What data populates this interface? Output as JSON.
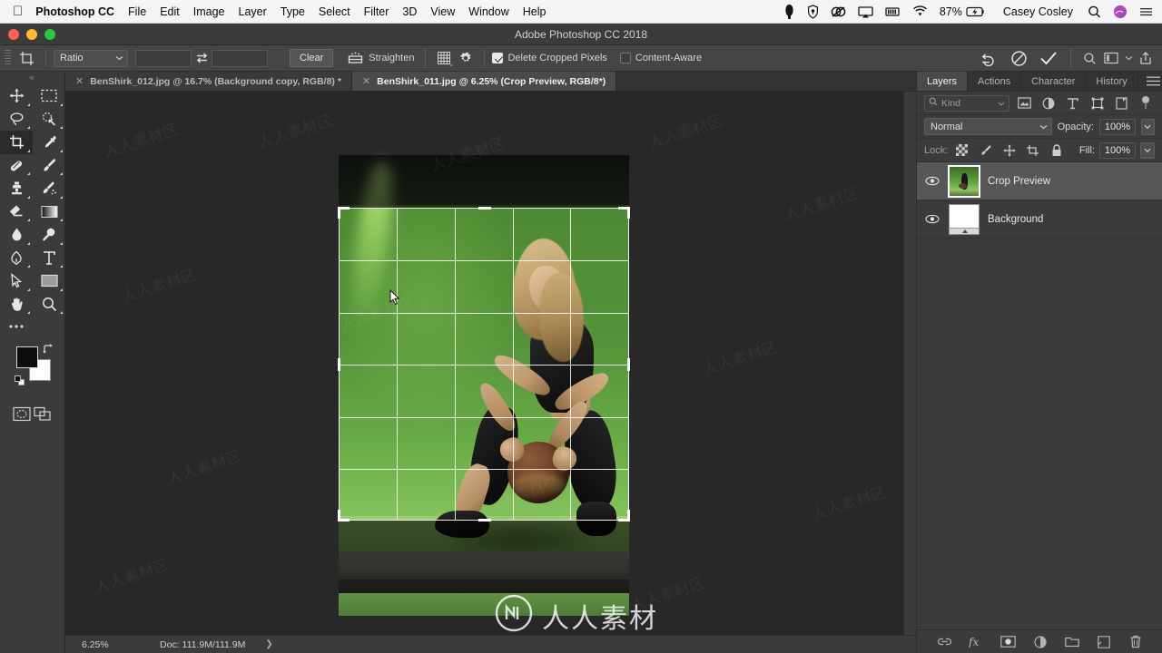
{
  "macbar": {
    "apple_icon": "apple-logo-icon",
    "app_name": "Photoshop CC",
    "menus": [
      "File",
      "Edit",
      "Image",
      "Layer",
      "Type",
      "Select",
      "Filter",
      "3D",
      "View",
      "Window",
      "Help"
    ],
    "status_icons": [
      "dropbox-icon",
      "shield-icon",
      "adobe-cc-icon",
      "airplay-icon",
      "battery-bar-icon",
      "wifi-icon"
    ],
    "battery_percent": "87%",
    "battery_charging_icon": "battery-charging-icon",
    "username": "Casey Cosley",
    "spotlight_icon": "search-icon",
    "siri_icon": "siri-icon",
    "control_center_icon": "list-icon"
  },
  "titlebar": {
    "title": "Adobe Photoshop CC 2018",
    "close_label": "close",
    "minimize_label": "minimize",
    "zoom_label": "zoom"
  },
  "options_bar": {
    "tool_icon": "crop-tool-icon",
    "ratio_select": "Ratio",
    "width_value": "",
    "height_value": "",
    "swap_icon": "swap-arrows-icon",
    "clear_label": "Clear",
    "straighten_icon": "straighten-icon",
    "straighten_label": "Straighten",
    "overlay_icon": "crop-overlay-grid-icon",
    "settings_icon": "gear-icon",
    "delete_cropped_pixels": {
      "label": "Delete Cropped Pixels",
      "checked": true
    },
    "content_aware": {
      "label": "Content-Aware",
      "checked": false
    },
    "reset_icon": "reset-arrow-icon",
    "cancel_icon": "cancel-circle-icon",
    "commit_icon": "checkmark-icon",
    "right_icons": [
      "search-icon",
      "workspace-icon",
      "chevron-down-icon",
      "share-icon"
    ]
  },
  "tabs": [
    {
      "label": "BenShirk_012.jpg @ 16.7% (Background copy, RGB/8) *",
      "active": false,
      "close_icon": "close-icon"
    },
    {
      "label": "BenShirk_011.jpg @ 6.25% (Crop Preview, RGB/8*)",
      "active": true,
      "close_icon": "close-icon"
    }
  ],
  "toolbar": {
    "grip_icon": "panel-grip-icon",
    "tools": [
      {
        "name": "move-tool-icon",
        "selected": false
      },
      {
        "name": "rectangular-marquee-tool-icon",
        "selected": false
      },
      {
        "name": "lasso-tool-icon",
        "selected": false
      },
      {
        "name": "quick-selection-tool-icon",
        "selected": false
      },
      {
        "name": "crop-tool-icon",
        "selected": true
      },
      {
        "name": "eyedropper-tool-icon",
        "selected": false
      },
      {
        "name": "healing-brush-tool-icon",
        "selected": false
      },
      {
        "name": "brush-tool-icon",
        "selected": false
      },
      {
        "name": "clone-stamp-tool-icon",
        "selected": false
      },
      {
        "name": "history-brush-tool-icon",
        "selected": false
      },
      {
        "name": "eraser-tool-icon",
        "selected": false
      },
      {
        "name": "gradient-tool-icon",
        "selected": false
      },
      {
        "name": "blur-tool-icon",
        "selected": false
      },
      {
        "name": "dodge-tool-icon",
        "selected": false
      },
      {
        "name": "pen-tool-icon",
        "selected": false
      },
      {
        "name": "type-tool-icon",
        "selected": false
      },
      {
        "name": "path-selection-tool-icon",
        "selected": false
      },
      {
        "name": "rectangle-tool-icon",
        "selected": false
      },
      {
        "name": "hand-tool-icon",
        "selected": false
      },
      {
        "name": "zoom-tool-icon",
        "selected": false
      }
    ],
    "more_tools_icon": "more-tools-icon",
    "foreground_color": "#0d0d0d",
    "background_color": "#fdfdfd",
    "swap_colors_icon": "swap-colors-icon",
    "default_colors_icon": "default-colors-icon",
    "quick_mask_icon": "quick-mask-icon",
    "screen_mode_icon": "screen-mode-icon"
  },
  "canvas": {
    "image_description": "Woman crouching with basketball on green backdrop",
    "crop_overlay_grid": "rule-of-thirds-grid",
    "cursor_icon": "arrow-cursor-icon"
  },
  "status_bar": {
    "zoom_level": "6.25%",
    "doc_label": "Doc: 111.9M/111.9M",
    "expand_icon": "chevron-right-icon"
  },
  "right_panel": {
    "tabs": [
      {
        "label": "Layers",
        "active": true
      },
      {
        "label": "Actions",
        "active": false
      },
      {
        "label": "Character",
        "active": false
      },
      {
        "label": "History",
        "active": false
      }
    ],
    "panel_menu_icon": "hamburger-menu-icon",
    "filter": {
      "search_icon": "search-icon",
      "kind_label": "Kind",
      "chevron_icon": "chevron-down-icon",
      "filter_icons": [
        "pixel-layer-filter-icon",
        "adjustment-layer-filter-icon",
        "type-layer-filter-icon",
        "shape-layer-filter-icon",
        "smart-object-filter-icon"
      ],
      "toggle_icon": "filter-toggle-icon"
    },
    "blend_mode": "Normal",
    "opacity_label": "Opacity:",
    "opacity_value": "100%",
    "lock_label": "Lock:",
    "lock_icons": [
      "lock-transparent-pixels-icon",
      "lock-image-pixels-icon",
      "lock-position-icon",
      "lock-artboard-icon",
      "lock-all-icon"
    ],
    "fill_label": "Fill:",
    "fill_value": "100%",
    "layers": [
      {
        "name": "Crop Preview",
        "visible": true,
        "selected": true,
        "visibility_icon": "eye-icon",
        "thumbnail": "crop-preview-thumbnail"
      },
      {
        "name": "Background",
        "visible": true,
        "selected": false,
        "visibility_icon": "eye-icon",
        "thumbnail": "background-thumbnail"
      }
    ],
    "bottom_icons": [
      "link-layers-icon",
      "layer-style-fx-icon",
      "add-layer-mask-icon",
      "new-adjustment-layer-icon",
      "new-group-icon",
      "new-layer-icon",
      "delete-layer-icon"
    ]
  },
  "watermark": {
    "logo_icon": "rrsc-logo-icon",
    "text": "人人素材"
  },
  "colors": {
    "panel_bg": "#3b3b3b",
    "options_bg": "#454545",
    "canvas_bg": "#282828",
    "selected_layer": "#575757",
    "tab_active": "#4a4a4a"
  }
}
